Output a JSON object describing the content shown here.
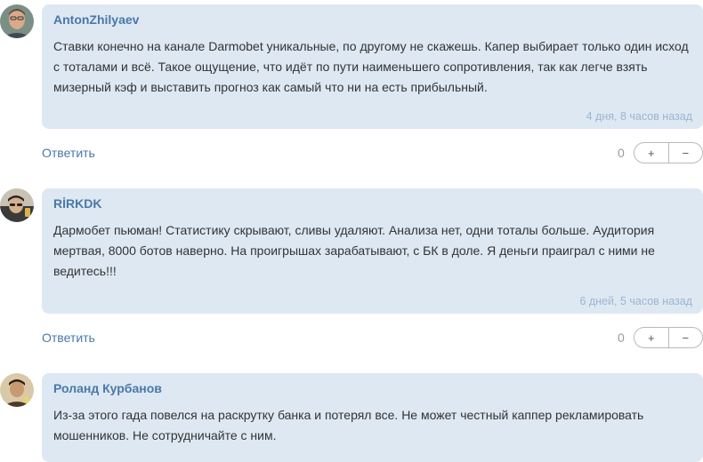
{
  "comments": [
    {
      "author": "AntonZhilyaev",
      "text": "Ставки конечно на канале Darmobet уникальные, по другому не скажешь. Капер выбирает только один исход с тоталами и всё. Такое ощущение, что идёт по пути наименьшего сопротивления, так как легче взять мизерный кэф и выставить прогноз как самый что ни на есть прибыльный.",
      "time": "4 дня, 8 часов назад",
      "reply_label": "Ответить",
      "vote_count": "0",
      "plus_label": "+",
      "minus_label": "−"
    },
    {
      "author": "RİRKDK",
      "text": "Дармобет пьюман! Статистику скрывают, сливы удаляют. Анализа нет, одни тоталы больше. Аудитория мертвая, 8000 ботов наверно. На проигрышах зарабатывают, с БК в доле. Я деньги праиграл с ними не ведитесь!!!",
      "time": "6 дней, 5 часов назад",
      "reply_label": "Ответить",
      "vote_count": "0",
      "plus_label": "+",
      "minus_label": "−"
    },
    {
      "author": "Роланд Курбанов",
      "text": "Из-за этого гада повелся на раскрутку банка и потерял все. Не может честный каппер рекламировать мошенников. Не сотрудничайте с ним.",
      "time": "",
      "reply_label": "",
      "vote_count": "",
      "plus_label": "",
      "minus_label": ""
    }
  ],
  "colors": {
    "bubble": "#dde8f3",
    "author": "#4a78a8",
    "time": "#9cb6d0",
    "text": "#333333"
  }
}
